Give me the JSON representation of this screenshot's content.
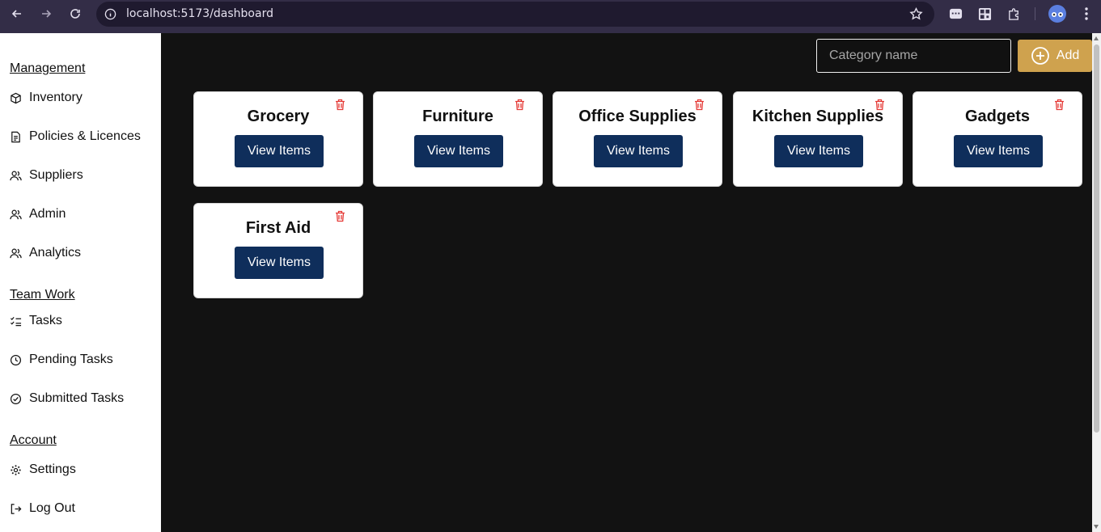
{
  "browser": {
    "url": "localhost:5173/dashboard",
    "colors": {
      "toolbar": "#332d47",
      "omnibox": "#1f1a2f"
    }
  },
  "sidebar": {
    "sections": [
      {
        "title": "Management",
        "items": [
          {
            "label": "Inventory",
            "icon": "box-icon"
          },
          {
            "label": "Policies & Licences",
            "icon": "document-icon"
          },
          {
            "label": "Suppliers",
            "icon": "users-icon"
          },
          {
            "label": "Admin",
            "icon": "users-icon"
          },
          {
            "label": "Analytics",
            "icon": "users-icon"
          }
        ]
      },
      {
        "title": "Team Work",
        "items": [
          {
            "label": "Tasks",
            "icon": "checklist-icon"
          },
          {
            "label": "Pending Tasks",
            "icon": "clock-icon"
          },
          {
            "label": "Submitted Tasks",
            "icon": "check-circle-icon"
          }
        ]
      },
      {
        "title": "Account",
        "items": [
          {
            "label": "Settings",
            "icon": "gear-icon"
          },
          {
            "label": "Log Out",
            "icon": "logout-icon"
          }
        ]
      }
    ]
  },
  "toolbar": {
    "category_placeholder": "Category name",
    "category_value": "",
    "add_label": "Add"
  },
  "categories": [
    {
      "name": "Grocery",
      "button": "View Items"
    },
    {
      "name": "Furniture",
      "button": "View Items"
    },
    {
      "name": "Office Supplies",
      "button": "View Items"
    },
    {
      "name": "Kitchen Supplies",
      "button": "View Items"
    },
    {
      "name": "Gadgets",
      "button": "View Items"
    },
    {
      "name": "First Aid",
      "button": "View Items"
    }
  ],
  "colors": {
    "main_bg": "#121212",
    "add_button": "#cfa24e",
    "view_button": "#0f2e5b",
    "delete_icon": "#e53935"
  }
}
